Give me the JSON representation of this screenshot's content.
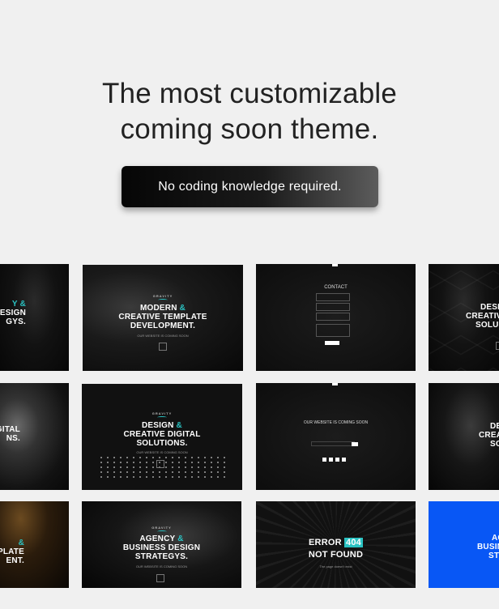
{
  "hero": {
    "headline_line1": "The most customizable",
    "headline_line2": "coming soon theme.",
    "cta_label": "No coding knowledge required."
  },
  "tiles": {
    "r1c0": {
      "line1": "Y &",
      "line2": "DESIGN",
      "line3": "GYS."
    },
    "r1c1": {
      "logo": "GRAVITY",
      "line1": "MODERN",
      "amp": "&",
      "line2": "CREATIVE TEMPLATE",
      "line3": "DEVELOPMENT.",
      "sub": "OUR WEBSITE IS COMING SOON"
    },
    "r1c2": {
      "heading": "CONTACT"
    },
    "r1c3": {
      "line1": "DESI",
      "line2": "CREATIVE",
      "line3": "SOLU"
    },
    "r2c0": {
      "line1": "GITAL",
      "line2": "NS."
    },
    "r2c1": {
      "logo": "GRAVITY",
      "line1": "DESIGN",
      "amp": "&",
      "line2": "CREATIVE DIGITAL",
      "line3": "SOLUTIONS.",
      "sub": "OUR WEBSITE IS COMING SOON"
    },
    "r2c2": {
      "heading": "OUR WEBSITE IS COMING SOON"
    },
    "r2c3": {
      "line1": "DE",
      "line2": "CREAT",
      "line3": "SO"
    },
    "r3c0": {
      "line1": "&",
      "line2": "PLATE",
      "line3": "ENT."
    },
    "r3c1": {
      "logo": "GRAVITY",
      "line1": "AGENCY",
      "amp": "&",
      "line2": "BUSINESS DESIGN",
      "line3": "STRATEGYS.",
      "sub": "OUR WEBSITE IS COMING SOON"
    },
    "r3c2": {
      "error": "ERROR",
      "code": "404",
      "line2": "NOT FOUND",
      "sub": "The page doesn't exist"
    },
    "r3c3": {
      "line1": "AG",
      "line2": "BUSIN",
      "line3": "STR"
    }
  }
}
